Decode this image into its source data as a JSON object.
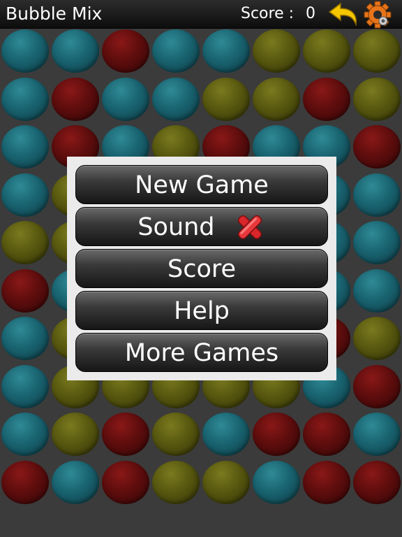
{
  "header": {
    "title": "Bubble Mix",
    "score_label": "Score :",
    "score_value": "0",
    "undo_icon": "undo-arrow-icon",
    "settings_icon": "gear-icon"
  },
  "menu": {
    "items": [
      {
        "label": "New Game"
      },
      {
        "label": "Sound",
        "status_icon": "red-x-icon"
      },
      {
        "label": "Score"
      },
      {
        "label": "Help"
      },
      {
        "label": "More Games"
      }
    ]
  },
  "board": {
    "colors": {
      "teal": "#196370",
      "red": "#5e0d0d",
      "yellow": "#585810"
    },
    "rows": [
      [
        "teal",
        "teal",
        "red",
        "teal",
        "teal",
        "yellow",
        "yellow",
        "yellow"
      ],
      [
        "teal",
        "red",
        "teal",
        "teal",
        "yellow",
        "yellow",
        "red",
        "yellow"
      ],
      [
        "teal",
        "red",
        "teal",
        "yellow",
        "red",
        "teal",
        "teal",
        "red"
      ],
      [
        "teal",
        "yellow",
        "teal",
        "teal",
        "teal",
        "teal",
        "teal",
        "teal"
      ],
      [
        "yellow",
        "yellow",
        "teal",
        "teal",
        "teal",
        "teal",
        "teal",
        "teal"
      ],
      [
        "red",
        "teal",
        "teal",
        "teal",
        "teal",
        "teal",
        "teal",
        "teal"
      ],
      [
        "teal",
        "yellow",
        "teal",
        "teal",
        "teal",
        "teal",
        "red",
        "yellow"
      ],
      [
        "teal",
        "yellow",
        "yellow",
        "yellow",
        "yellow",
        "yellow",
        "teal",
        "red"
      ],
      [
        "teal",
        "yellow",
        "red",
        "yellow",
        "teal",
        "red",
        "red",
        "teal"
      ],
      [
        "red",
        "teal",
        "red",
        "yellow",
        "yellow",
        "teal",
        "red",
        "red"
      ]
    ]
  }
}
